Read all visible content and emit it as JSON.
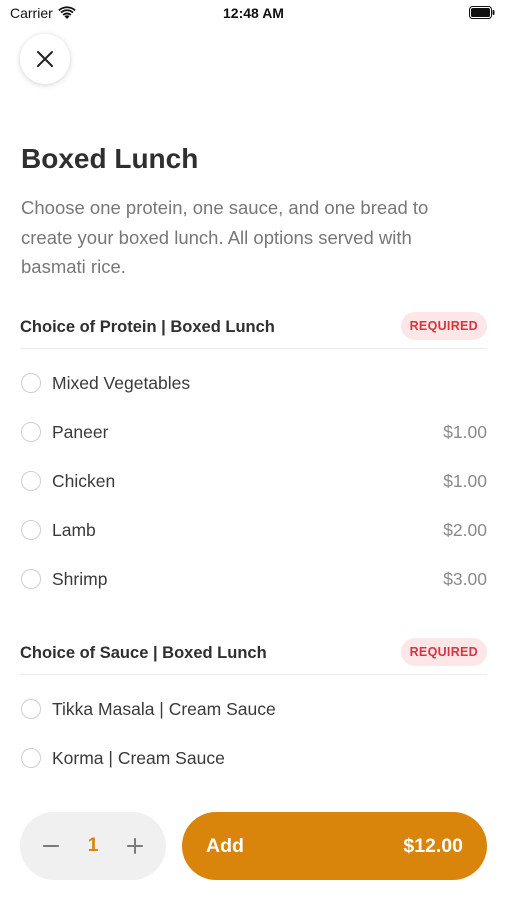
{
  "status_bar": {
    "carrier": "Carrier",
    "time": "12:48 AM"
  },
  "item": {
    "title": "Boxed Lunch",
    "description": "Choose one protein, one sauce, and one bread to create your boxed lunch. All options served with basmati rice."
  },
  "sections": [
    {
      "title": "Choice of Protein | Boxed Lunch",
      "badge": "REQUIRED",
      "options": [
        {
          "label": "Mixed Vegetables",
          "price": ""
        },
        {
          "label": "Paneer",
          "price": "$1.00"
        },
        {
          "label": "Chicken",
          "price": "$1.00"
        },
        {
          "label": "Lamb",
          "price": "$2.00"
        },
        {
          "label": "Shrimp",
          "price": "$3.00"
        }
      ]
    },
    {
      "title": "Choice of Sauce | Boxed Lunch",
      "badge": "REQUIRED",
      "options": [
        {
          "label": "Tikka Masala | Cream Sauce",
          "price": ""
        },
        {
          "label": "Korma | Cream Sauce",
          "price": ""
        }
      ]
    }
  ],
  "footer": {
    "quantity": "1",
    "add_label": "Add",
    "total": "$12.00"
  },
  "colors": {
    "accent": "#d9840b",
    "required_bg": "#fde6e8",
    "required_text": "#d9343f"
  }
}
